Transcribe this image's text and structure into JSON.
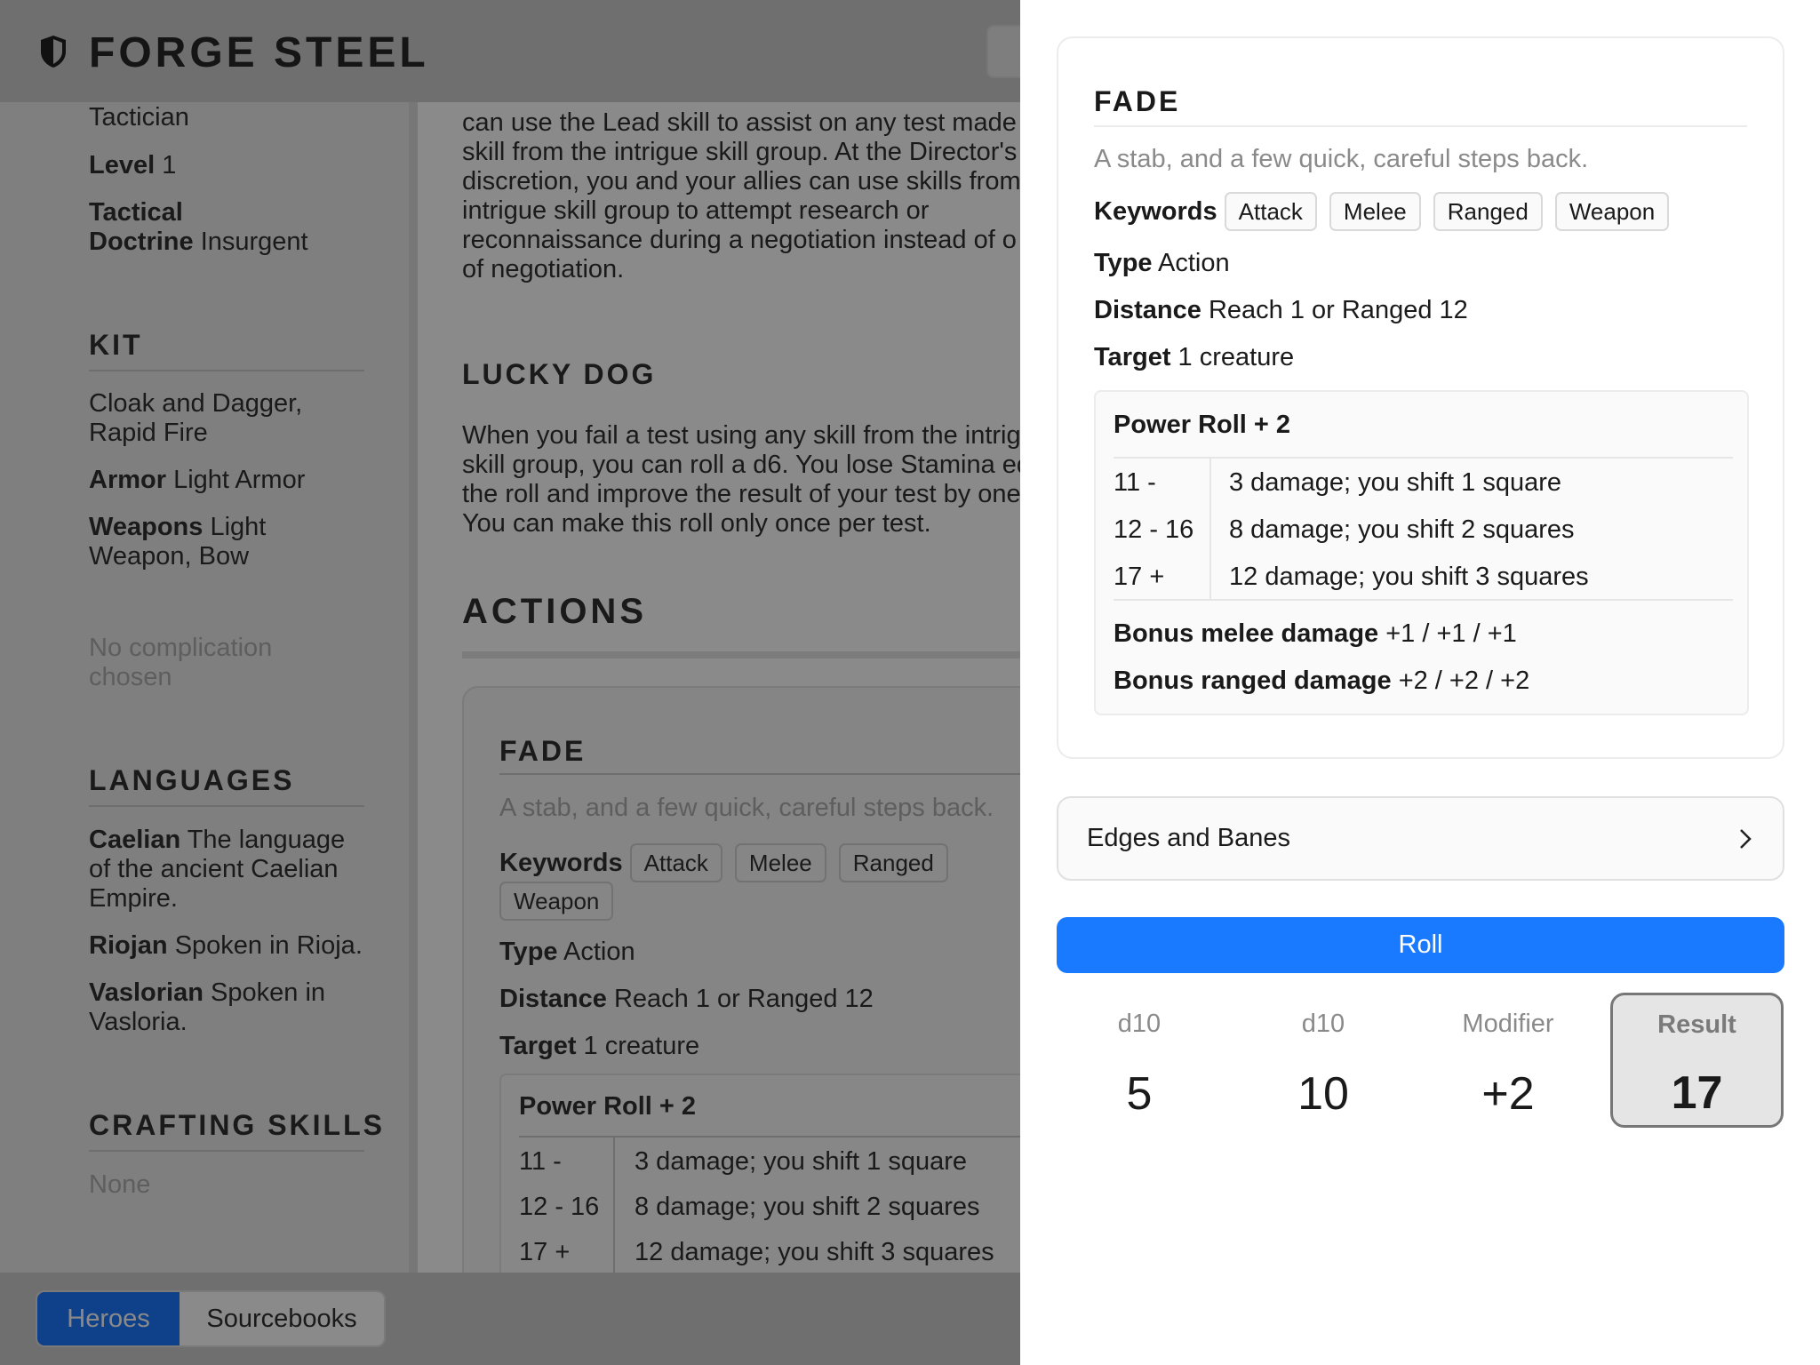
{
  "app": {
    "title": "FORGE STEEL",
    "logo_icon": "shield-icon"
  },
  "sidebar": {
    "class_tail": "Tactician",
    "level": {
      "label": "Level",
      "value": "1"
    },
    "doctrine": {
      "label1": "Tactical",
      "label2": "Doctrine",
      "value": "Insurgent"
    },
    "kit": {
      "heading": "KIT",
      "name1": "Cloak and Dagger,",
      "name2": "Rapid Fire",
      "armor_label": "Armor",
      "armor": "Light Armor",
      "weapons_label": "Weapons",
      "weapons1": "Light",
      "weapons2": "Weapon, Bow"
    },
    "complication1": "No complication",
    "complication2": "chosen",
    "languages": {
      "heading": "LANGUAGES",
      "items": [
        {
          "name": "Caelian",
          "l1": "The language",
          "l2": "of the ancient Caelian",
          "l3": "Empire."
        },
        {
          "name": "Riojan",
          "l1": "Spoken in Rioja."
        },
        {
          "name": "Vaslorian",
          "l1": "Spoken in",
          "l2": "Vasloria."
        }
      ]
    },
    "crafting": {
      "heading": "CRAFTING SKILLS",
      "value": "None"
    }
  },
  "main": {
    "intro_lines": [
      "can use the Lead skill to assist on any test made",
      "skill from the intrigue skill group. At the Director's",
      "discretion, you and your allies can use skills from",
      "intrigue skill group to attempt research or",
      "reconnaissance during a negotiation instead of o",
      "of negotiation."
    ],
    "lucky_dog": {
      "heading": "LUCKY DOG",
      "lines": [
        "When you fail a test using any skill from the intrig",
        "skill group, you can roll a d6. You lose Stamina eq",
        "the roll and improve the result of your test by one",
        "You can make this roll only once per test."
      ]
    },
    "actions_heading": "ACTIONS",
    "fade": {
      "title": "FADE",
      "desc": "A stab, and a few quick, careful steps back.",
      "keywords_label": "Keywords",
      "keywords": [
        "Attack",
        "Melee",
        "Ranged",
        "Weapon"
      ],
      "type_label": "Type",
      "type": "Action",
      "distance_label": "Distance",
      "distance": "Reach 1 or Ranged 12",
      "target_label": "Target",
      "target": "1 creature",
      "power_roll": "Power Roll + 2",
      "tiers": [
        [
          "11 -",
          "3 damage; you shift 1 square"
        ],
        [
          "12 - 16",
          "8 damage; you shift 2 squares"
        ],
        [
          "17 +",
          "12 damage; you shift 3 squares"
        ]
      ]
    }
  },
  "footer": {
    "tabs": [
      "Heroes",
      "Sourcebooks"
    ],
    "active": "Heroes"
  },
  "drawer": {
    "fade": {
      "title": "FADE",
      "desc": "A stab, and a few quick, careful steps back.",
      "keywords_label": "Keywords",
      "keywords": [
        "Attack",
        "Melee",
        "Ranged",
        "Weapon"
      ],
      "type_label": "Type",
      "type": "Action",
      "distance_label": "Distance",
      "distance": "Reach 1 or Ranged 12",
      "target_label": "Target",
      "target": "1 creature",
      "power_roll": "Power Roll + 2",
      "tiers": [
        [
          "11 -",
          "3 damage; you shift 1 square"
        ],
        [
          "12 - 16",
          "8 damage; you shift 2 squares"
        ],
        [
          "17 +",
          "12 damage; you shift 3 squares"
        ]
      ],
      "bonus_melee_label": "Bonus melee damage",
      "bonus_melee": "+1 / +1 / +1",
      "bonus_ranged_label": "Bonus ranged damage",
      "bonus_ranged": "+2 / +2 / +2"
    },
    "edges_banes": "Edges and Banes",
    "roll": "Roll",
    "results": [
      {
        "label": "d10",
        "value": "5"
      },
      {
        "label": "d10",
        "value": "10"
      },
      {
        "label": "Modifier",
        "value": "+2"
      },
      {
        "label": "Result",
        "value": "17"
      }
    ],
    "colors": {
      "accent": "#1a7aff"
    }
  }
}
